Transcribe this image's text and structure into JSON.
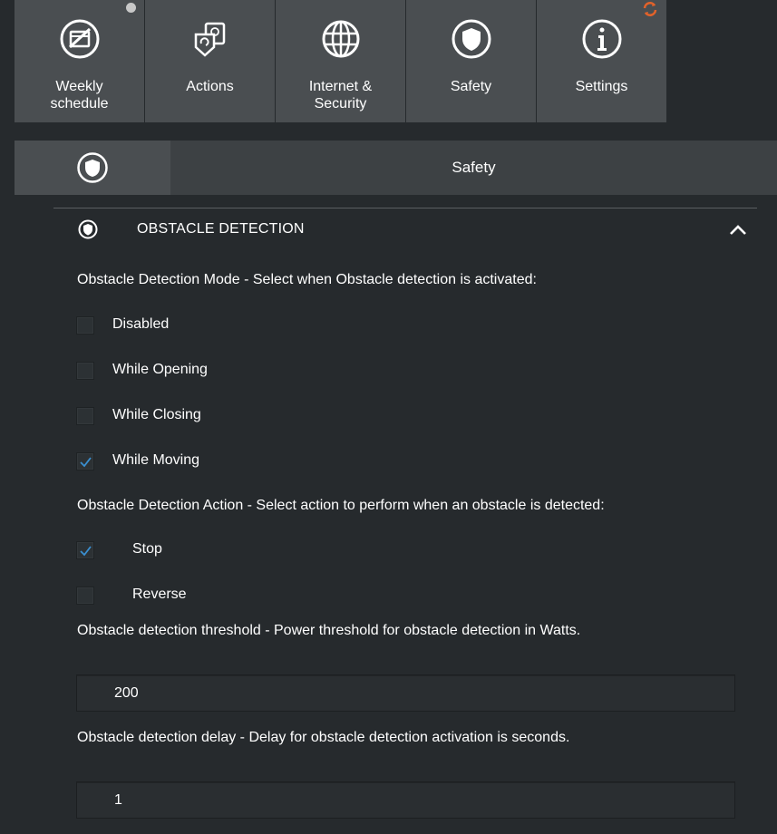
{
  "nav": {
    "tiles": [
      {
        "label_line1": "Weekly",
        "label_line2": "schedule",
        "icon": "calendar-clock-icon",
        "indicator": "grey-dot"
      },
      {
        "label": "Actions",
        "icon": "actions-icon"
      },
      {
        "label_line1": "Internet &",
        "label_line2": "Security",
        "icon": "globe-icon"
      },
      {
        "label": "Safety",
        "icon": "shield-icon"
      },
      {
        "label": "Settings",
        "icon": "info-icon",
        "indicator": "sync-icon"
      }
    ]
  },
  "section_header": {
    "title": "Safety",
    "icon": "shield-icon"
  },
  "accordion": {
    "title": "OBSTACLE DETECTION",
    "icon": "shield-icon",
    "expanded": true
  },
  "mode": {
    "label": "Obstacle Detection Mode - Select when Obstacle detection is activated:",
    "options": [
      {
        "label": "Disabled",
        "checked": false
      },
      {
        "label": "While Opening",
        "checked": false
      },
      {
        "label": "While Closing",
        "checked": false
      },
      {
        "label": "While Moving",
        "checked": true
      }
    ]
  },
  "action": {
    "label": "Obstacle Detection Action - Select action to perform when an obstacle is detected:",
    "options": [
      {
        "label": "Stop",
        "checked": true
      },
      {
        "label": "Reverse",
        "checked": false
      }
    ]
  },
  "threshold": {
    "label": "Obstacle detection threshold - Power threshold for obstacle detection in Watts.",
    "value": "200"
  },
  "delay": {
    "label": "Obstacle detection delay - Delay for obstacle detection activation is seconds.",
    "value": "1"
  },
  "colors": {
    "background": "#262a2d",
    "tile": "#4a4e51",
    "check": "#3a8fd0",
    "sync": "#e2622a"
  }
}
